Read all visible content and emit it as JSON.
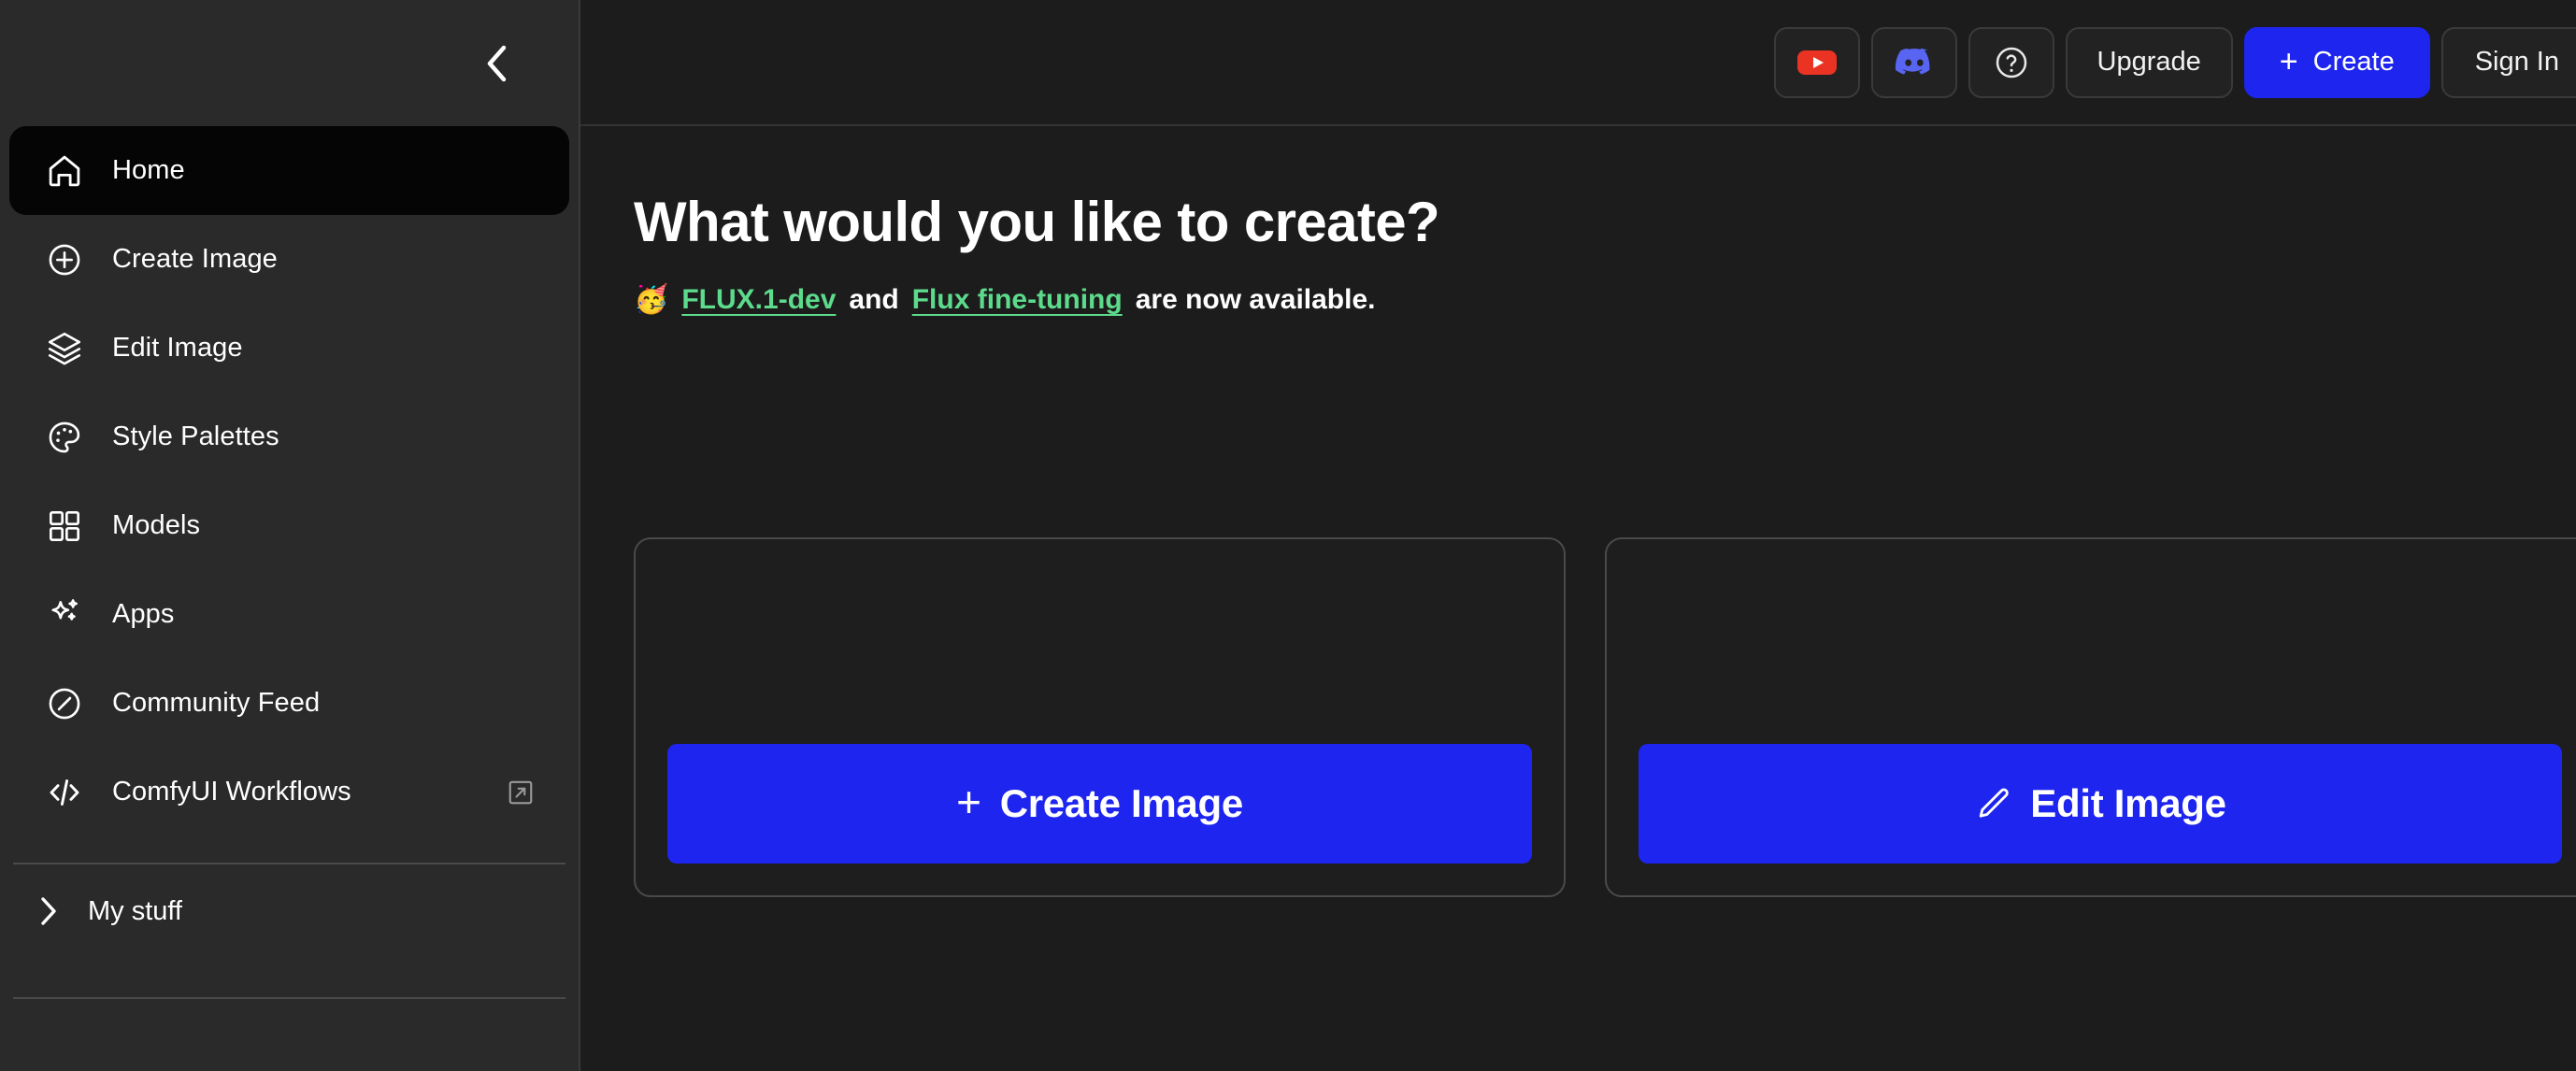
{
  "sidebar": {
    "collapse_icon": "chevron-left-icon",
    "items": [
      {
        "label": "Home",
        "icon": "home-icon",
        "active": true
      },
      {
        "label": "Create Image",
        "icon": "plus-circle-icon",
        "active": false
      },
      {
        "label": "Edit Image",
        "icon": "layers-icon",
        "active": false
      },
      {
        "label": "Style Palettes",
        "icon": "palette-icon",
        "active": false
      },
      {
        "label": "Models",
        "icon": "grid-icon",
        "active": false
      },
      {
        "label": "Apps",
        "icon": "sparkle-icon",
        "active": false
      },
      {
        "label": "Community Feed",
        "icon": "compass-icon",
        "active": false
      },
      {
        "label": "ComfyUI Workflows",
        "icon": "code-icon",
        "active": false,
        "external": true,
        "external_icon": "external-link-icon"
      }
    ],
    "group": {
      "label": "My stuff",
      "icon": "chevron-right-icon"
    }
  },
  "topbar": {
    "youtube_label": "youtube-icon",
    "discord_label": "discord-icon",
    "help_label": "help-circle-icon",
    "upgrade_label": "Upgrade",
    "create_label": "Create",
    "create_plus": "+",
    "signin_label": "Sign In"
  },
  "main": {
    "title": "What would you like to create?",
    "announcement": {
      "emoji": "🥳",
      "link1": "FLUX.1-dev",
      "middle": "and",
      "link2": "Flux fine-tuning",
      "tail": "are now available."
    },
    "cards": [
      {
        "button_label": "Create Image",
        "button_icon": "plus-icon"
      },
      {
        "button_label": "Edit Image",
        "button_icon": "pencil-icon"
      }
    ]
  },
  "colors": {
    "accent_blue": "#1e25ee",
    "link_green": "#5ddb8c",
    "sidebar_bg": "#2a2a2a",
    "content_bg": "#1c1c1c",
    "card_bg": "#1e1e1e",
    "youtube_red": "#ea3323",
    "discord_purple": "#5865f2",
    "active_item_bg": "#050505"
  }
}
